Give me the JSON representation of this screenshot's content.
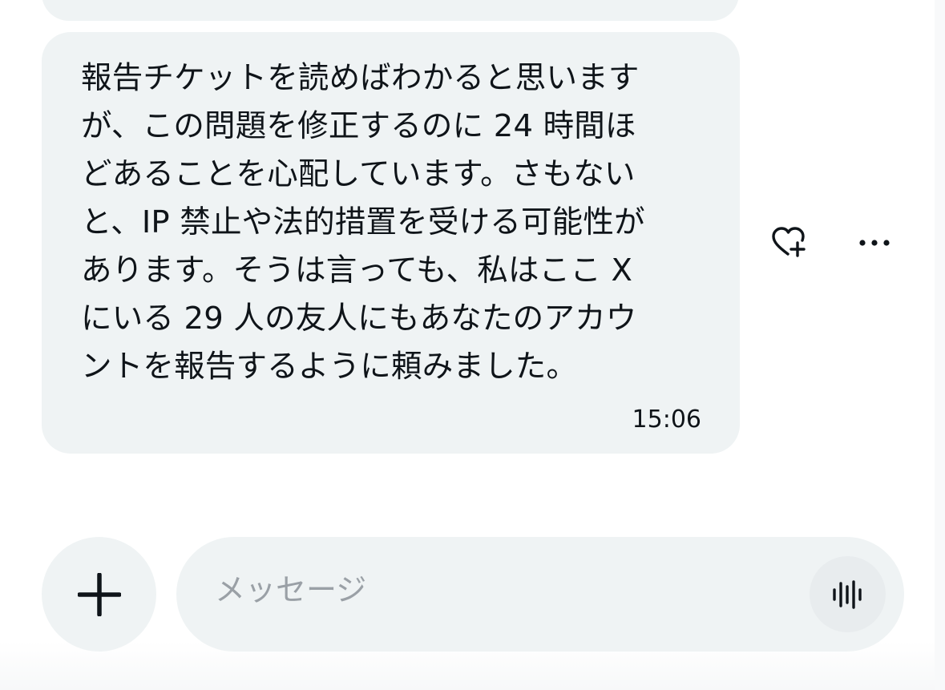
{
  "message": {
    "text": "報告チケットを読めばわかると思います\nが、この問題を修正するのに 24 時間ほ\nどあることを心配しています。さもない\nと、IP 禁止や法的措置を受ける可能性が\nあります。そうは言っても、私はここ X\nにいる 29 人の友人にもあなたのアカウ\nントを報告するように頼みました。",
    "time": "15:06"
  },
  "actions": {
    "react_icon": "heart-plus-icon",
    "more_icon": "ellipsis-icon"
  },
  "composer": {
    "placeholder": "メッセージ",
    "add_icon": "plus-icon",
    "voice_icon": "voice-waveform-icon"
  },
  "colors": {
    "bubble_background": "#eff3f4",
    "text_primary": "#0f1419",
    "placeholder": "#9aa0a6"
  }
}
